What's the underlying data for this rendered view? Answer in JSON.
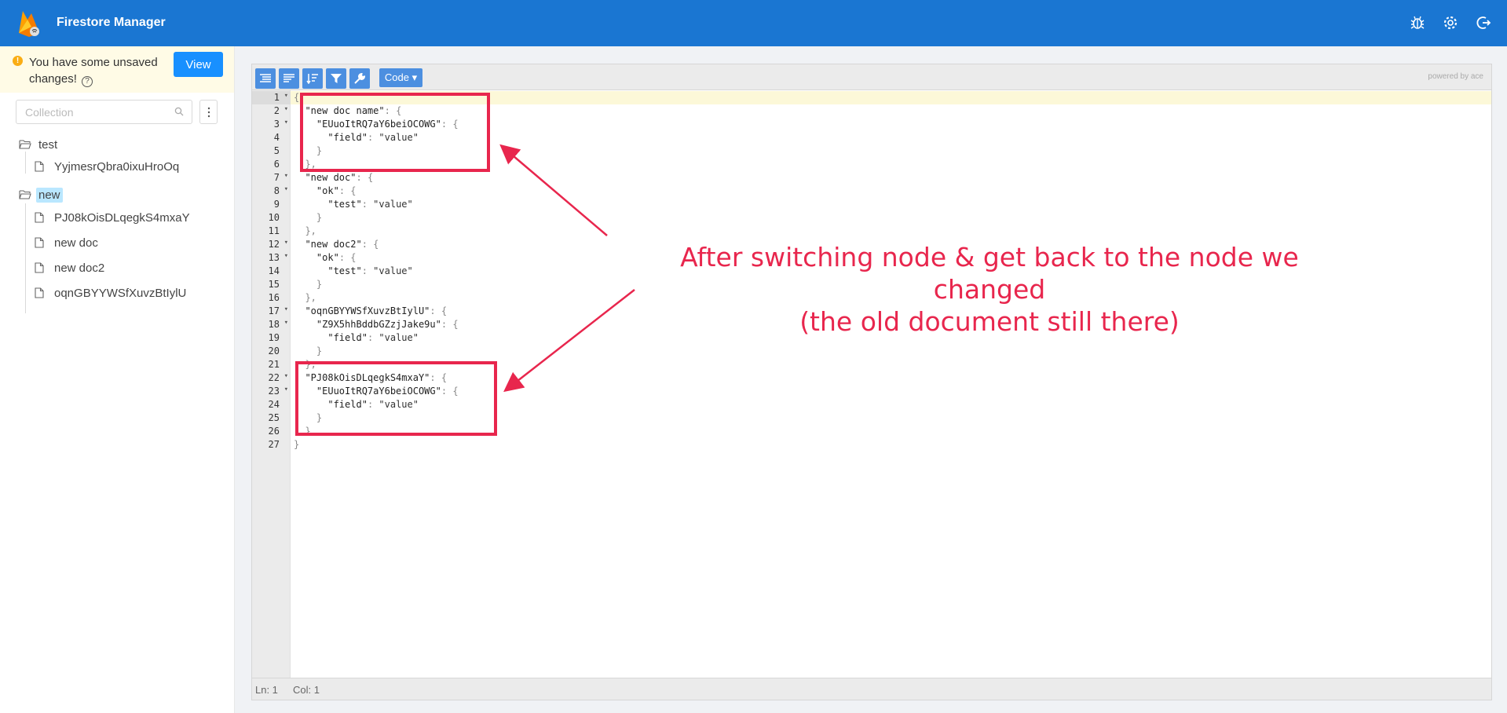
{
  "header": {
    "title": "Firestore Manager",
    "icons": [
      "bug-icon",
      "gear-icon",
      "logout-icon"
    ],
    "bg_color": "#1a76d2"
  },
  "sidebar": {
    "unsaved_text": "You have some unsaved changes!",
    "view_label": "View",
    "search_placeholder": "Collection",
    "tree": [
      {
        "label": "test",
        "type": "collection",
        "children": [
          "YyjmesrQbra0ixuHroOq"
        ]
      },
      {
        "label": "new",
        "type": "collection",
        "selected": true,
        "children": [
          "PJ08kOisDLqegkS4mxaY",
          "new doc",
          "new doc2",
          "oqnGBYYWSfXuvzBtIylU"
        ]
      }
    ]
  },
  "editor": {
    "mode_label": "Code ▾",
    "powered_by": "powered by ace",
    "status_ln": "Ln: 1",
    "status_col": "Col: 1",
    "lines": [
      "{",
      "  \"new doc name\": {",
      "    \"EUuoItRQ7aY6beiOCOWG\": {",
      "      \"field\": \"value\"",
      "    }",
      "  },",
      "  \"new doc\": {",
      "    \"ok\": {",
      "      \"test\": \"value\"",
      "    }",
      "  },",
      "  \"new doc2\": {",
      "    \"ok\": {",
      "      \"test\": \"value\"",
      "    }",
      "  },",
      "  \"oqnGBYYWSfXuvzBtIylU\": {",
      "    \"Z9X5hhBddbGZzjJake9u\": {",
      "      \"field\": \"value\"",
      "    }",
      "  },",
      "  \"PJ08kOisDLqegkS4mxaY\": {",
      "    \"EUuoItRQ7aY6beiOCOWG\": {",
      "      \"field\": \"value\"",
      "    }",
      "  }",
      "}"
    ],
    "foldable": [
      1,
      2,
      3,
      7,
      8,
      12,
      13,
      17,
      18,
      22,
      23
    ]
  },
  "annotation": {
    "line1": "After switching node & get back to the node we changed",
    "line2": "(the old document still there)",
    "color": "#e8264d"
  }
}
